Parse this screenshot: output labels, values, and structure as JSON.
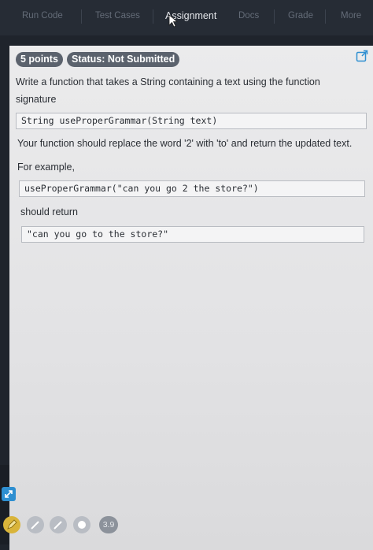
{
  "nav": {
    "tabs": [
      {
        "label": "Run Code",
        "active": false
      },
      {
        "label": "Test Cases",
        "active": false
      },
      {
        "label": "Assignment",
        "active": true
      },
      {
        "label": "Docs",
        "active": false
      },
      {
        "label": "Grade",
        "active": false
      },
      {
        "label": "More",
        "active": false
      }
    ]
  },
  "assignment": {
    "points_badge": "5 points",
    "status_badge": "Status: Not Submitted",
    "intro_line1": "Write a function that takes a String containing a text using the function",
    "intro_line2": "signature",
    "signature_code": "String useProperGrammar(String text)",
    "instruction": "Your function should replace the word '2' with 'to' and return the updated text.",
    "example_label": "For example,",
    "example_call": "useProperGrammar(\"can you go 2 the store?\")",
    "should_return_label": "should return",
    "example_result": "\"can you go to the store?\""
  },
  "footer": {
    "version_badge": "3.9"
  },
  "colors": {
    "nav_bg": "#262c35",
    "panel_bg": "#ebebec",
    "badge_bg": "#5b626d",
    "accent_blue": "#2e8fd1",
    "accent_yellow": "#d9b43a"
  },
  "icons": {
    "external_link": "external-link-icon",
    "resize": "expand-arrows-icon",
    "pencil": "pencil-icon",
    "cursor": "mouse-cursor-icon"
  }
}
